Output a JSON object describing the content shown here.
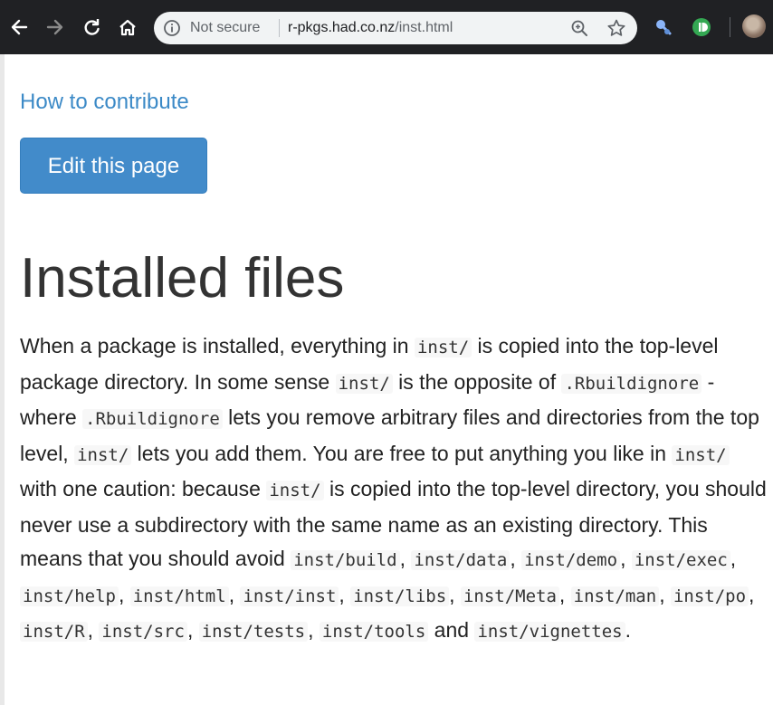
{
  "browser": {
    "security_label": "Not secure",
    "url_host": "r-pkgs.had.co.nz",
    "url_path": "/inst.html"
  },
  "page": {
    "contribute_link": "How to contribute",
    "edit_button": "Edit this page",
    "title": "Installed files",
    "paragraph": [
      {
        "t": "text",
        "v": "When a package is installed, everything in "
      },
      {
        "t": "code",
        "v": "inst/"
      },
      {
        "t": "text",
        "v": " is copied into the top-level package directory. In some sense "
      },
      {
        "t": "code",
        "v": "inst/"
      },
      {
        "t": "text",
        "v": " is the opposite of "
      },
      {
        "t": "code",
        "v": ".Rbuildignore"
      },
      {
        "t": "text",
        "v": " - where "
      },
      {
        "t": "code",
        "v": ".Rbuildignore"
      },
      {
        "t": "text",
        "v": " lets you remove arbitrary files and directories from the top level, "
      },
      {
        "t": "code",
        "v": "inst/"
      },
      {
        "t": "text",
        "v": " lets you add them. You are free to put anything you like in "
      },
      {
        "t": "code",
        "v": "inst/"
      },
      {
        "t": "text",
        "v": " with one caution: because "
      },
      {
        "t": "code",
        "v": "inst/"
      },
      {
        "t": "text",
        "v": " is copied into the top-level directory, you should never use a subdirectory with the same name as an existing directory. This means that you should avoid "
      },
      {
        "t": "code",
        "v": "inst/build"
      },
      {
        "t": "text",
        "v": ", "
      },
      {
        "t": "code",
        "v": "inst/data"
      },
      {
        "t": "text",
        "v": ", "
      },
      {
        "t": "code",
        "v": "inst/demo"
      },
      {
        "t": "text",
        "v": ", "
      },
      {
        "t": "code",
        "v": "inst/exec"
      },
      {
        "t": "text",
        "v": ", "
      },
      {
        "t": "code",
        "v": "inst/help"
      },
      {
        "t": "text",
        "v": ", "
      },
      {
        "t": "code",
        "v": "inst/html"
      },
      {
        "t": "text",
        "v": ", "
      },
      {
        "t": "code",
        "v": "inst/inst"
      },
      {
        "t": "text",
        "v": ", "
      },
      {
        "t": "code",
        "v": "inst/libs"
      },
      {
        "t": "text",
        "v": ", "
      },
      {
        "t": "code",
        "v": "inst/Meta"
      },
      {
        "t": "text",
        "v": ", "
      },
      {
        "t": "code",
        "v": "inst/man"
      },
      {
        "t": "text",
        "v": ", "
      },
      {
        "t": "code",
        "v": "inst/po"
      },
      {
        "t": "text",
        "v": ", "
      },
      {
        "t": "code",
        "v": "inst/R"
      },
      {
        "t": "text",
        "v": ", "
      },
      {
        "t": "code",
        "v": "inst/src"
      },
      {
        "t": "text",
        "v": ", "
      },
      {
        "t": "code",
        "v": "inst/tests"
      },
      {
        "t": "text",
        "v": ", "
      },
      {
        "t": "code",
        "v": "inst/tools"
      },
      {
        "t": "text",
        "v": " and "
      },
      {
        "t": "code",
        "v": "inst/vignettes"
      },
      {
        "t": "text",
        "v": "."
      }
    ]
  },
  "colors": {
    "link": "#3c8ac7",
    "button": "#428bca",
    "toolbar": "#202124"
  }
}
